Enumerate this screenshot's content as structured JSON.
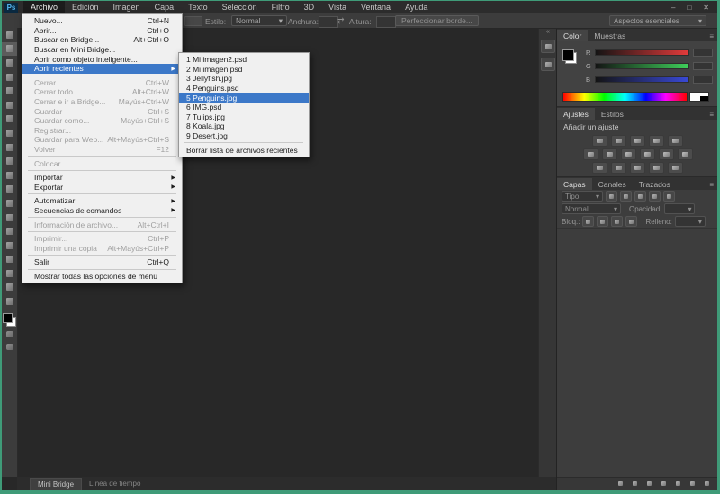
{
  "colors": {
    "accent_blue": "#3c78c8",
    "border_green": "#3f9b78",
    "menu_bg": "#f0f0f0",
    "panel_bg": "#3d3d3d",
    "canvas_bg": "#282828",
    "disabled_text": "#9f9f9f"
  },
  "titlebar": {
    "logo": "Ps",
    "menus": [
      "Archivo",
      "Edición",
      "Imagen",
      "Capa",
      "Texto",
      "Selección",
      "Filtro",
      "3D",
      "Vista",
      "Ventana",
      "Ayuda"
    ],
    "active_menu": "Archivo",
    "window_controls": [
      {
        "name": "minimize-button",
        "glyph": "–"
      },
      {
        "name": "restore-button",
        "glyph": "□"
      },
      {
        "name": "close-button",
        "glyph": "✕"
      }
    ]
  },
  "options_bar": {
    "style_label": "Estilo:",
    "style_value": "Normal",
    "dropdown_arrow": "▾",
    "width_label": "Anchura:",
    "swap_icon": "⇄",
    "height_label": "Altura:",
    "refine_button": "Perfeccionar borde...",
    "workspace": "Aspectos esenciales"
  },
  "file_menu": {
    "items": [
      {
        "label": "Nuevo...",
        "shortcut": "Ctrl+N"
      },
      {
        "label": "Abrir...",
        "shortcut": "Ctrl+O"
      },
      {
        "label": "Buscar en Bridge...",
        "shortcut": "Alt+Ctrl+O"
      },
      {
        "label": "Buscar en Mini Bridge..."
      },
      {
        "label": "Abrir como objeto inteligente..."
      },
      {
        "label": "Abrir recientes",
        "submenu": true,
        "highlight": true
      },
      {
        "sep": true
      },
      {
        "label": "Cerrar",
        "shortcut": "Ctrl+W",
        "disabled": true
      },
      {
        "label": "Cerrar todo",
        "shortcut": "Alt+Ctrl+W",
        "disabled": true
      },
      {
        "label": "Cerrar e ir a Bridge...",
        "shortcut": "Mayús+Ctrl+W",
        "disabled": true
      },
      {
        "label": "Guardar",
        "shortcut": "Ctrl+S",
        "disabled": true
      },
      {
        "label": "Guardar como...",
        "shortcut": "Mayús+Ctrl+S",
        "disabled": true
      },
      {
        "label": "Registrar...",
        "disabled": true
      },
      {
        "label": "Guardar para Web...",
        "shortcut": "Alt+Mayús+Ctrl+S",
        "disabled": true
      },
      {
        "label": "Volver",
        "shortcut": "F12",
        "disabled": true
      },
      {
        "sep": true
      },
      {
        "label": "Colocar...",
        "disabled": true
      },
      {
        "sep": true
      },
      {
        "label": "Importar",
        "submenu": true
      },
      {
        "label": "Exportar",
        "submenu": true
      },
      {
        "sep": true
      },
      {
        "label": "Automatizar",
        "submenu": true
      },
      {
        "label": "Secuencias de comandos",
        "submenu": true
      },
      {
        "sep": true
      },
      {
        "label": "Información de archivo...",
        "shortcut": "Alt+Ctrl+I",
        "disabled": true
      },
      {
        "sep": true
      },
      {
        "label": "Imprimir...",
        "shortcut": "Ctrl+P",
        "disabled": true
      },
      {
        "label": "Imprimir una copia",
        "shortcut": "Alt+Mayús+Ctrl+P",
        "disabled": true
      },
      {
        "sep": true
      },
      {
        "label": "Salir",
        "shortcut": "Ctrl+Q"
      },
      {
        "sep": true
      },
      {
        "label": "Mostrar todas las opciones de menú"
      }
    ]
  },
  "recent_submenu": {
    "items": [
      "1 Mi imagen2.psd",
      "2 Mi imagen.psd",
      "3 Jellyfish.jpg",
      "4 Penguins.psd",
      "5 Penguins.jpg",
      "6 IMG.psd",
      "7 Tulips.jpg",
      "8 Koala.jpg",
      "9 Desert.jpg"
    ],
    "highlight_index": 4,
    "clear_label": "Borrar lista de archivos recientes"
  },
  "toolbar": {
    "selected_index": 1,
    "tools": [
      "move-tool",
      "rectangular-marquee-tool",
      "lasso-tool",
      "quick-selection-tool",
      "crop-tool",
      "eyedropper-tool",
      "healing-brush-tool",
      "brush-tool",
      "clone-stamp-tool",
      "history-brush-tool",
      "eraser-tool",
      "gradient-tool",
      "blur-tool",
      "dodge-tool",
      "pen-tool",
      "type-tool",
      "path-selection-tool",
      "shape-tool",
      "hand-tool",
      "zoom-tool"
    ],
    "extras": [
      "quick-mask-mode",
      "screen-mode"
    ]
  },
  "mini_dock": {
    "expander": "«",
    "buttons": [
      "properties-panel",
      "history-panel"
    ]
  },
  "panels": {
    "color": {
      "tabs": [
        "Color",
        "Muestras"
      ],
      "active_tab": "Color",
      "menu_icon": "≡",
      "channels": [
        {
          "label": "R",
          "color": "#e23b3b"
        },
        {
          "label": "G",
          "color": "#3ecf5a"
        },
        {
          "label": "B",
          "color": "#3949d6"
        }
      ]
    },
    "ajustes": {
      "tabs": [
        "Ajustes",
        "Estilos"
      ],
      "active_tab": "Ajustes",
      "header": "Añadir un ajuste",
      "icon_rows": [
        5,
        6,
        5
      ],
      "icons": [
        "brightness-contrast",
        "levels",
        "curves",
        "exposure",
        "vibrance",
        "hue-saturation",
        "color-balance",
        "black-white",
        "photo-filter",
        "channel-mixer",
        "color-lookup",
        "invert",
        "posterize",
        "threshold",
        "gradient-map",
        "selective-color"
      ]
    },
    "capas": {
      "tabs": [
        "Capas",
        "Canales",
        "Trazados"
      ],
      "active_tab": "Capas",
      "menu_icon": "≡",
      "filter_label": "Tipo",
      "dropdown_arrow": "▾",
      "blend_mode": "Normal",
      "opacity_label": "Opacidad:",
      "lock_label": "Bloq.:",
      "fill_label": "Relleno:",
      "filter_icons": [
        "pixel-filter",
        "adjustment-filter",
        "type-filter",
        "shape-filter",
        "smart-object-filter"
      ],
      "lock_icons": [
        "lock-transparent",
        "lock-pixels",
        "lock-position",
        "lock-all"
      ],
      "bottom_icons": [
        "link-layers",
        "layer-effects",
        "layer-mask",
        "adjustment-layer",
        "layer-group",
        "new-layer",
        "delete-layer"
      ]
    }
  },
  "bottom_tabs": {
    "tabs": [
      "Mini Bridge",
      "Línea de tiempo"
    ],
    "active_tab": "Mini Bridge"
  }
}
